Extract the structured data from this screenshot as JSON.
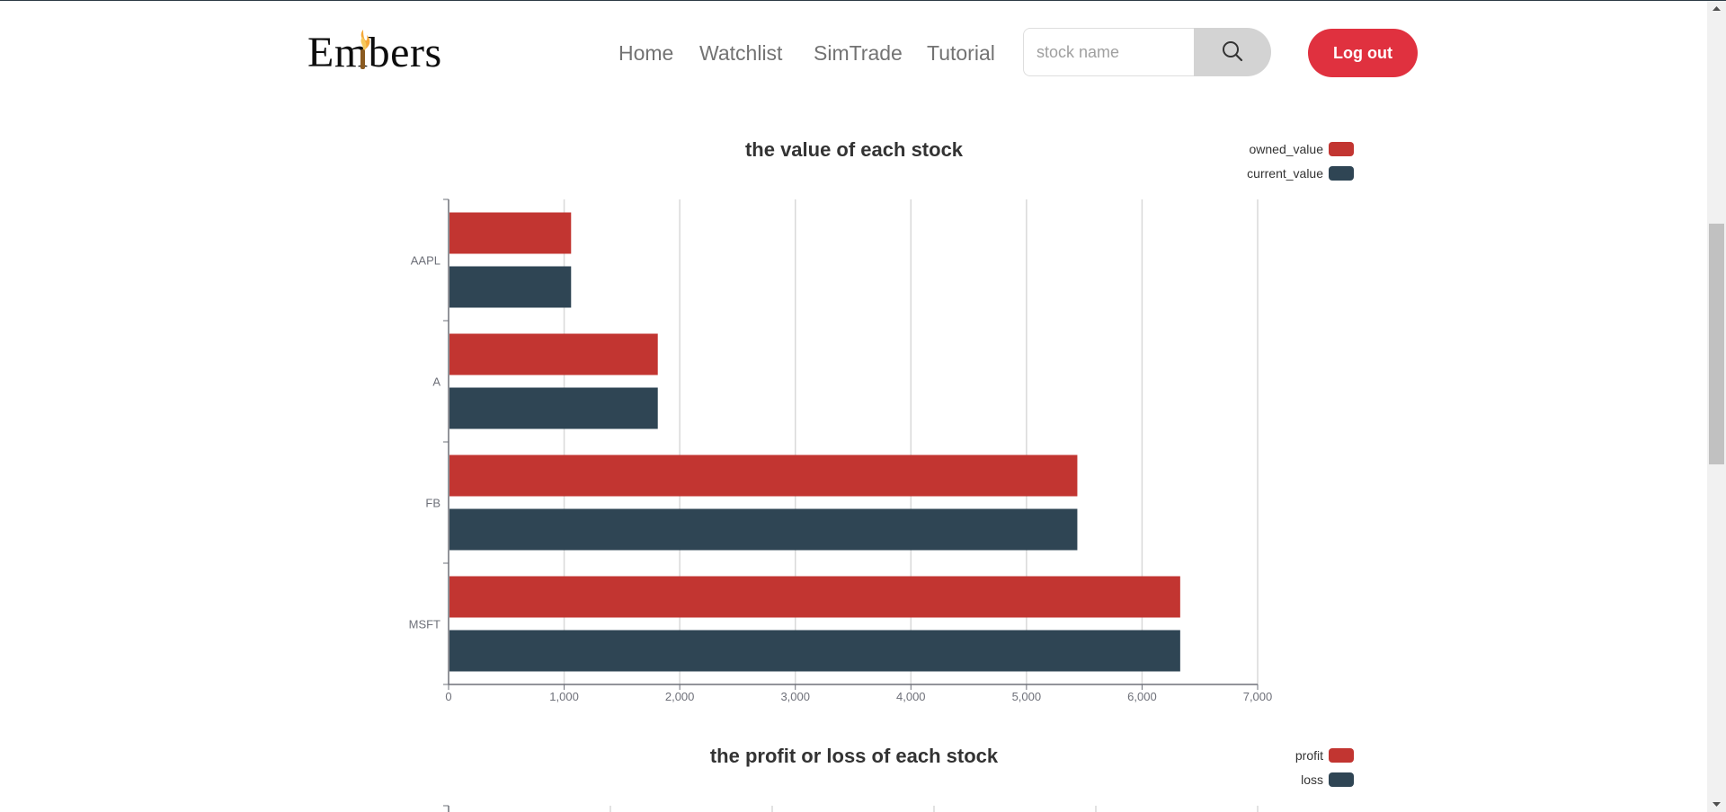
{
  "header": {
    "logo_text": "Embers",
    "nav": [
      "Home",
      "Watchlist",
      "SimTrade",
      "Tutorial"
    ],
    "search_placeholder": "stock name",
    "logout_label": "Log out"
  },
  "colors": {
    "red": "#c23531",
    "navy": "#2f4554",
    "button": "#e0313f"
  },
  "chart_data": [
    {
      "type": "bar",
      "orientation": "horizontal",
      "title": "the value of each stock",
      "categories": [
        "AAPL",
        "A",
        "FB",
        "MSFT"
      ],
      "series": [
        {
          "name": "owned_value",
          "values": [
            1060,
            1810,
            5440,
            6330
          ]
        },
        {
          "name": "current_value",
          "values": [
            1060,
            1810,
            5440,
            6330
          ]
        }
      ],
      "xlim": [
        0,
        7000
      ],
      "xticks": [
        "0",
        "1,000",
        "2,000",
        "3,000",
        "4,000",
        "5,000",
        "6,000",
        "7,000"
      ],
      "grid": true,
      "legend": "top-right"
    },
    {
      "type": "bar",
      "orientation": "horizontal",
      "title": "the profit or loss of each stock",
      "series": [
        {
          "name": "profit"
        },
        {
          "name": "loss"
        }
      ],
      "legend": "top-right"
    }
  ]
}
